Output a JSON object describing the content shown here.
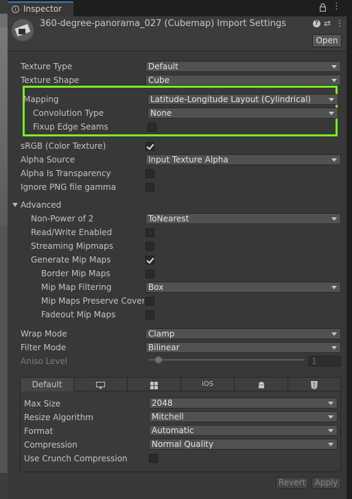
{
  "tab": {
    "title": "Inspector"
  },
  "header": {
    "asset_title": "360-degree-panorama_027 (Cubemap) Import Settings",
    "open_label": "Open"
  },
  "fields": {
    "texture_type": {
      "label": "Texture Type",
      "value": "Default"
    },
    "texture_shape": {
      "label": "Texture Shape",
      "value": "Cube"
    },
    "mapping": {
      "label": "Mapping",
      "value": "Latitude-Longitude Layout (Cylindrical)"
    },
    "convolution_type": {
      "label": "Convolution Type",
      "value": "None"
    },
    "fixup_edge_seams": {
      "label": "Fixup Edge Seams",
      "checked": false
    },
    "srgb": {
      "label": "sRGB (Color Texture)",
      "checked": true
    },
    "alpha_source": {
      "label": "Alpha Source",
      "value": "Input Texture Alpha"
    },
    "alpha_is_transparency": {
      "label": "Alpha Is Transparency",
      "checked": false
    },
    "ignore_png_gamma": {
      "label": "Ignore PNG file gamma",
      "checked": false
    }
  },
  "advanced": {
    "label": "Advanced",
    "non_power_of_2": {
      "label": "Non-Power of 2",
      "value": "ToNearest"
    },
    "read_write": {
      "label": "Read/Write Enabled",
      "checked": false
    },
    "streaming_mipmaps": {
      "label": "Streaming Mipmaps",
      "checked": false
    },
    "generate_mip_maps": {
      "label": "Generate Mip Maps",
      "checked": true
    },
    "border_mip_maps": {
      "label": "Border Mip Maps",
      "checked": false
    },
    "mip_map_filtering": {
      "label": "Mip Map Filtering",
      "value": "Box"
    },
    "mip_maps_preserve_coverage": {
      "label": "Mip Maps Preserve Covera",
      "checked": false
    },
    "fadeout_mip_maps": {
      "label": "Fadeout Mip Maps",
      "checked": false
    }
  },
  "wrap": {
    "wrap_mode": {
      "label": "Wrap Mode",
      "value": "Clamp"
    },
    "filter_mode": {
      "label": "Filter Mode",
      "value": "Bilinear"
    },
    "aniso_level": {
      "label": "Aniso Level",
      "value": "1"
    }
  },
  "platform": {
    "tabs": [
      {
        "label": "Default",
        "icon": ""
      },
      {
        "label": "",
        "icon": "monitor-icon"
      },
      {
        "label": "",
        "icon": "windows-icon"
      },
      {
        "label": "iOS",
        "icon": ""
      },
      {
        "label": "",
        "icon": "android-icon"
      },
      {
        "label": "",
        "icon": "html5-icon"
      }
    ],
    "max_size": {
      "label": "Max Size",
      "value": "2048"
    },
    "resize_algorithm": {
      "label": "Resize Algorithm",
      "value": "Mitchell"
    },
    "format": {
      "label": "Format",
      "value": "Automatic"
    },
    "compression": {
      "label": "Compression",
      "value": "Normal Quality"
    },
    "use_crunch": {
      "label": "Use Crunch Compression",
      "checked": false
    }
  },
  "buttons": {
    "revert": "Revert",
    "apply": "Apply"
  },
  "colors": {
    "highlight": "#77ee22",
    "tab_accent": "#3a79bb",
    "panel": "#383838"
  }
}
